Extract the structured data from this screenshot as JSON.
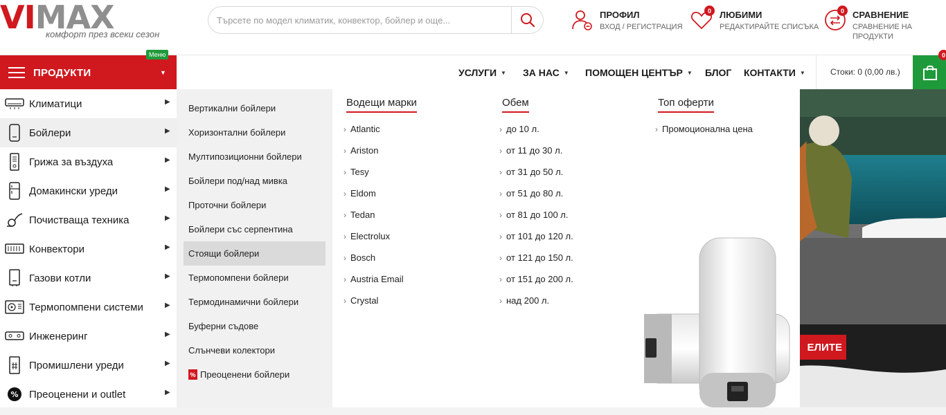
{
  "header": {
    "logo_text_red": "VI",
    "logo_text_gray": "MAX",
    "slogan": "комфорт през всеки сезон",
    "search_placeholder": "Търсете по модел климатик, конвектор, бойлер и още...",
    "profile": {
      "title": "ПРОФИЛ",
      "subtitle": "ВХОД / РЕГИСТРАЦИЯ"
    },
    "favorites": {
      "title": "ЛЮБИМИ",
      "subtitle": "РЕДАКТИРАЙТЕ СПИСЪКА",
      "count": "0"
    },
    "compare": {
      "title": "СРАВНЕНИЕ",
      "subtitle": "СРАВНЕНИЕ НА ПРОДУКТИ",
      "count": "0"
    }
  },
  "nav": {
    "products_label": "ПРОДУКТИ",
    "menu_tag": "Меню",
    "links": [
      {
        "label": "УСЛУГИ"
      },
      {
        "label": "ЗА НАС"
      },
      {
        "label": "ПОМОЩЕН ЦЕНТЪР"
      },
      {
        "label": "БЛОГ"
      },
      {
        "label": "КОНТАКТИ"
      }
    ],
    "cart_text": "Стоки: 0 (0,00 лв.)",
    "cart_count": "0"
  },
  "sidebar": {
    "items": [
      {
        "label": "Климатици",
        "icon": "air-conditioner-icon"
      },
      {
        "label": "Бойлери",
        "icon": "boiler-icon"
      },
      {
        "label": "Грижа за въздуха",
        "icon": "air-purifier-icon"
      },
      {
        "label": "Домакински уреди",
        "icon": "fridge-icon"
      },
      {
        "label": "Почистваща техника",
        "icon": "vacuum-icon"
      },
      {
        "label": "Конвектори",
        "icon": "convector-icon"
      },
      {
        "label": "Газови котли",
        "icon": "gas-boiler-icon"
      },
      {
        "label": "Термопомпени системи",
        "icon": "heat-pump-icon"
      },
      {
        "label": "Инженеринг",
        "icon": "engineering-icon"
      },
      {
        "label": "Промишлени уреди",
        "icon": "industrial-icon"
      },
      {
        "label": "Преоценени и outlet",
        "icon": "percent-icon"
      }
    ]
  },
  "submenu": {
    "items": [
      "Вертикални бойлери",
      "Хоризонтални бойлери",
      "Мултипозиционни бойлери",
      "Бойлери под/над мивка",
      "Проточни бойлери",
      "Бойлери със серпентина",
      "Стоящи бойлери",
      "Термопомпени бойлери",
      "Термодинамични бойлери",
      "Буферни съдове",
      "Слънчеви колектори",
      "Преоценени бойлери"
    ],
    "percent_badge": "%"
  },
  "mega": {
    "brands": {
      "title": "Водещи марки",
      "items": [
        "Atlantic",
        "Ariston",
        "Tesy",
        "Eldom",
        "Tedan",
        "Electrolux",
        "Bosch",
        "Austria Email",
        "Crystal"
      ]
    },
    "volume": {
      "title": "Обем",
      "items": [
        "до 10 л.",
        "от 11 до 30 л.",
        "от 31 до 50 л.",
        "от 51 до 80 л.",
        "от 81 до 100 л.",
        "от 101 до 120 л.",
        "от 121 до 150 л.",
        "от 151 до 200 л.",
        "над 200 л."
      ]
    },
    "offers": {
      "title": "Топ оферти",
      "items": [
        "Промоционална цена"
      ]
    }
  },
  "banner": {
    "button_label": "ЕЛИТЕ"
  },
  "colors": {
    "brand_red": "#d0181f",
    "brand_green": "#1f9a3a"
  }
}
